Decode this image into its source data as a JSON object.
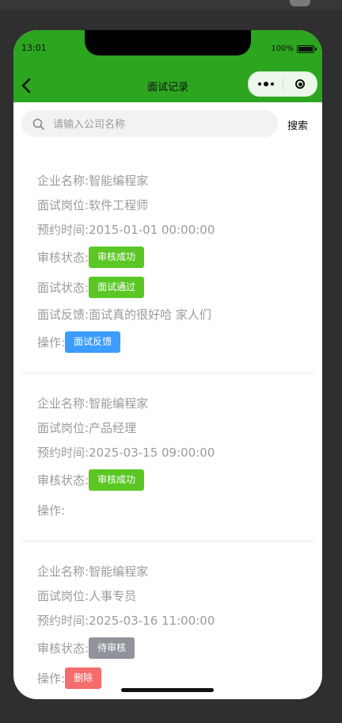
{
  "status_bar": {
    "time": "13:01",
    "battery": "100%"
  },
  "nav": {
    "title": "面试记录"
  },
  "search": {
    "placeholder": "请输入公司名称",
    "value": "",
    "button_label": "搜索"
  },
  "labels": {
    "company": "企业名称:",
    "position": "面试岗位:",
    "time": "预约时间:",
    "review": "审核状态:",
    "interview_status": "面试状态:",
    "feedback": "面试反馈:",
    "action": "操作:"
  },
  "records": [
    {
      "company": "智能编程家",
      "position": "软件工程师",
      "time": "2015-01-01 00:00:00",
      "review_status": "审核成功",
      "interview_status": "面试通过",
      "feedback": "面试真的很好哈 家人们",
      "action": "面试反馈"
    },
    {
      "company": "智能编程家",
      "position": "产品经理",
      "time": "2025-03-15 09:00:00",
      "review_status": "审核成功"
    },
    {
      "company": "智能编程家",
      "position": "人事专员",
      "time": "2025-03-16 11:00:00",
      "review_status": "待审核",
      "action": "删除"
    }
  ],
  "colors": {
    "header": "#2ca51f",
    "success_tag": "#5ac725",
    "pending_tag": "#909399",
    "feedback_button": "#3c9cff",
    "delete_button": "#f56c6c"
  }
}
